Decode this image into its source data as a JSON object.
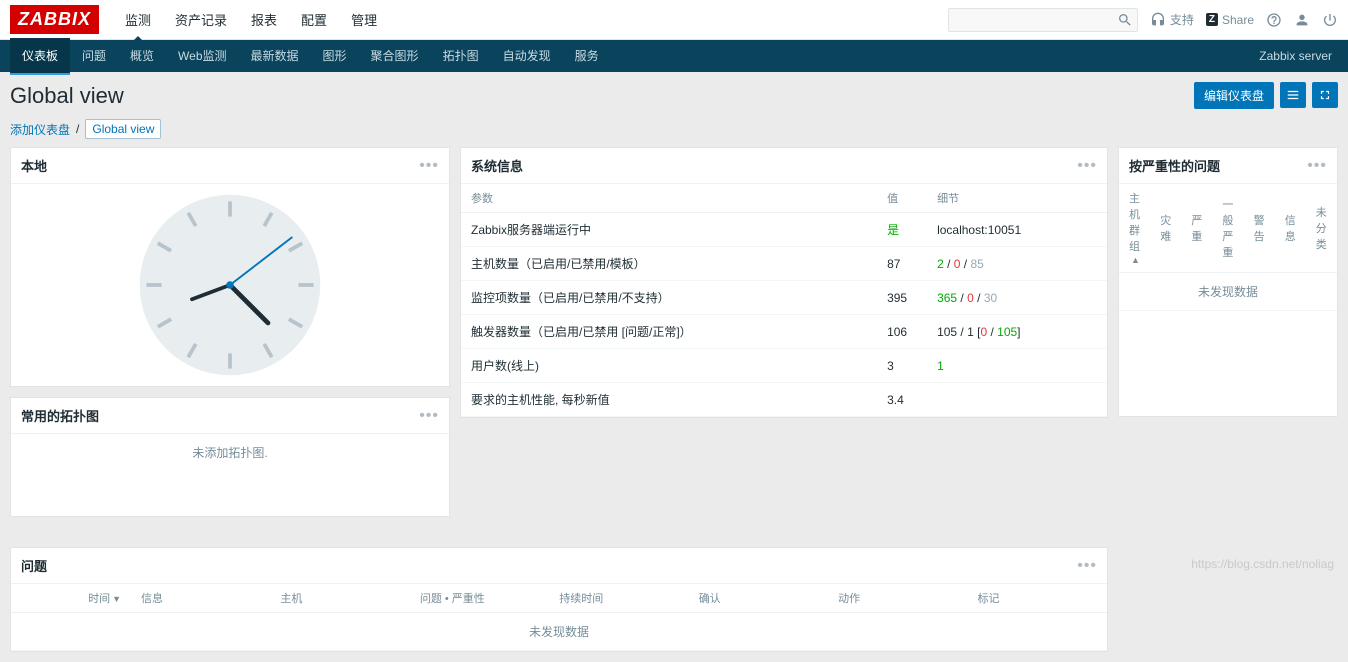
{
  "logo": "ZABBIX",
  "topnav": [
    "监测",
    "资产记录",
    "报表",
    "配置",
    "管理"
  ],
  "topnav_active": 0,
  "search": {
    "placeholder": ""
  },
  "toptools": {
    "support_label": "支持",
    "share_label": "Share",
    "share_badge": "Z"
  },
  "subnav": [
    "仪表板",
    "问题",
    "概览",
    "Web监测",
    "最新数据",
    "图形",
    "聚合图形",
    "拓扑图",
    "自动发现",
    "服务"
  ],
  "subnav_active": 0,
  "subright": "Zabbix server",
  "page": {
    "title": "Global view",
    "edit_btn": "编辑仪表盘"
  },
  "breadcrumb": {
    "add": "添加仪表盘",
    "sep": "/",
    "current": "Global view"
  },
  "sysinfo": {
    "title": "系统信息",
    "cols": [
      "参数",
      "值",
      "细节"
    ],
    "rows": [
      {
        "param": "Zabbix服务器端运行中",
        "value_html": "<span class='green'>是</span>",
        "detail_html": "localhost:10051"
      },
      {
        "param": "主机数量（已启用/已禁用/模板）",
        "value_html": "87",
        "detail_html": "<span class='green'>2</span> / <span class='red'>0</span> / <span class='grey'>85</span>"
      },
      {
        "param": "监控项数量（已启用/已禁用/不支持）",
        "value_html": "395",
        "detail_html": "<span class='green'>365</span> / <span class='red'>0</span> / <span class='grey'>30</span>"
      },
      {
        "param": "触发器数量（已启用/已禁用 [问题/正常]）",
        "value_html": "106",
        "detail_html": "105 / 1 [<span class='red'>0</span> / <span class='green'>105</span>]"
      },
      {
        "param": "用户数(线上)",
        "value_html": "3",
        "detail_html": "<span class='green'>1</span>"
      },
      {
        "param": "要求的主机性能, 每秒新值",
        "value_html": "3.4",
        "detail_html": ""
      }
    ]
  },
  "severity": {
    "title": "按严重性的问题",
    "cols": [
      "主机群组",
      "灾难",
      "严重",
      "一般严重",
      "警告",
      "信息",
      "未分类"
    ],
    "nodata": "未发现数据"
  },
  "clock": {
    "title": "本地"
  },
  "problems_widget": {
    "title": "问题",
    "cols": [
      "时间",
      "信息",
      "主机",
      "问题 • 严重性",
      "持续时间",
      "确认",
      "动作",
      "标记"
    ],
    "nodata": "未发现数据"
  },
  "maps": {
    "title": "常用的拓扑图",
    "nodata": "未添加拓扑图."
  },
  "watermark": "https://blog.csdn.net/noliag"
}
